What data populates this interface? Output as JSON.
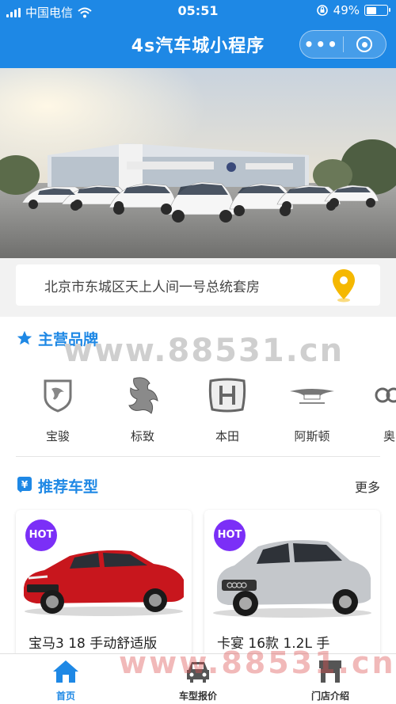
{
  "status_bar": {
    "carrier": "中国电信",
    "time": "05:51",
    "battery": "49%",
    "battery_level": 0.49
  },
  "nav": {
    "title": "4s汽车城小程序",
    "more": "•••"
  },
  "address": {
    "text": "北京市东城区天上人间一号总统套房"
  },
  "brands": {
    "title": "主营品牌",
    "watermark": "www.88531.cn",
    "items": [
      {
        "name": "宝骏",
        "icon": "baojun-logo"
      },
      {
        "name": "标致",
        "icon": "peugeot-logo"
      },
      {
        "name": "本田",
        "icon": "honda-logo"
      },
      {
        "name": "阿斯顿",
        "icon": "aston-martin-logo"
      },
      {
        "name": "奥",
        "icon": "audi-logo"
      }
    ]
  },
  "recommend": {
    "title": "推荐车型",
    "more": "更多",
    "cars": [
      {
        "badge": "HOT",
        "name": "宝马3 18 手动舒适版",
        "color": "#c8161d"
      },
      {
        "badge": "HOT",
        "name": "卡宴 16款 1.2L 手",
        "color": "#b9bcc0"
      }
    ]
  },
  "tabs": [
    {
      "label": "首页",
      "icon": "home-icon",
      "active": true
    },
    {
      "label": "车型报价",
      "icon": "car-icon",
      "active": false
    },
    {
      "label": "门店介绍",
      "icon": "store-icon",
      "active": false
    }
  ],
  "colors": {
    "primary": "#1e88e5",
    "hot": "#7b2ff7",
    "pin": "#f5b800"
  },
  "footer_watermark": "www.88531.cn"
}
